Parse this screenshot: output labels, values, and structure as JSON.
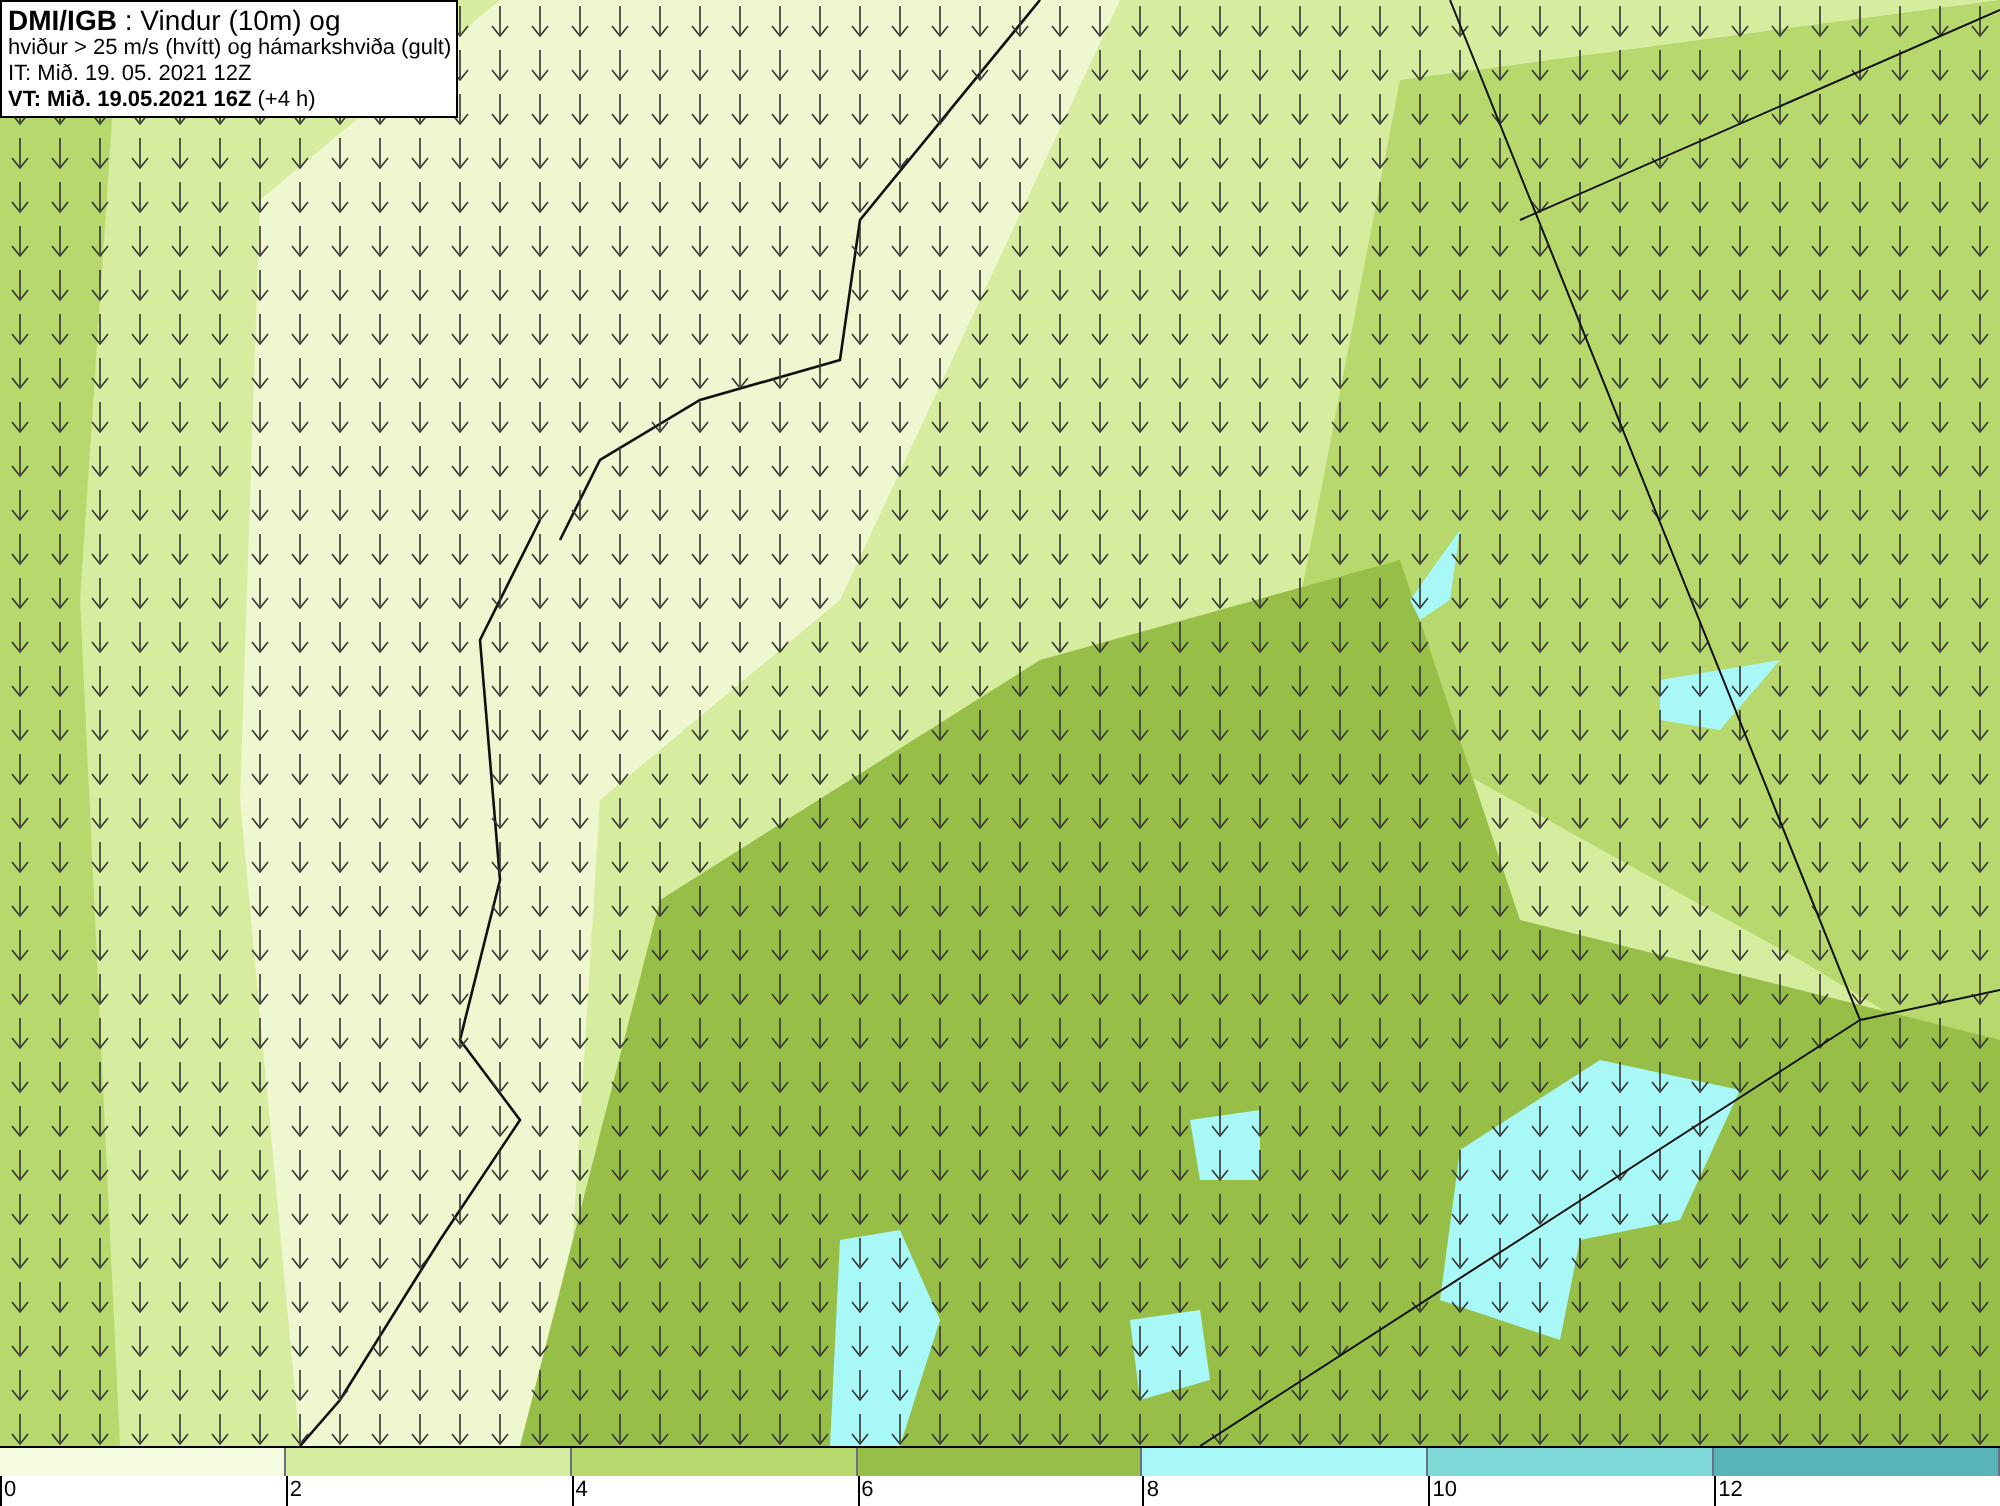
{
  "header": {
    "lines": [
      "**DMI/IGB** : Vindur (10m) og",
      "hviður > 25 m/s (hvítt) og hámarkshviða (gult)",
      "IT: Mið. 19. 05. 2021 12Z",
      "**VT: Mið. 19.05.2021 16Z** (+4 h)"
    ]
  },
  "legend": {
    "segments": [
      {
        "label": "0",
        "color": "#f5fbe0"
      },
      {
        "label": "2",
        "color": "#d6eda0"
      },
      {
        "label": "4",
        "color": "#b6d86c"
      },
      {
        "label": "6",
        "color": "#97bf47"
      },
      {
        "label": "8",
        "color": "#a8f8f8"
      },
      {
        "label": "10",
        "color": "#7ed8d8"
      },
      {
        "label": "12",
        "color": "#58b4b8"
      }
    ]
  }
}
